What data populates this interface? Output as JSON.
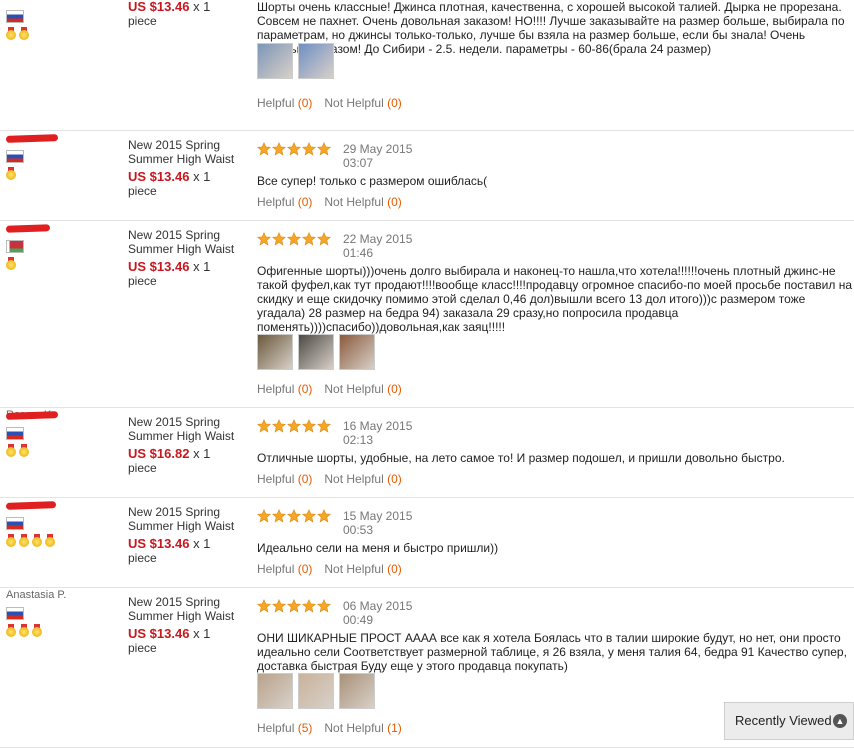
{
  "reviews": [
    {
      "user_name": "",
      "country": "ru",
      "medals": 2,
      "price": "US $13.46",
      "qty": "x 1",
      "unit": "piece",
      "product": "",
      "stars": 5,
      "date": "",
      "time": "",
      "text": "Шорты очень классные! Джинса плотная, качественна, с хорошей высокой талией. Дырка не прорезана. Совсем не пахнет. Очень довольная заказом! НО!!!! Лучше заказывайте на размер больше, выбирала по параметрам, но джинсы только-только, лучше бы взяла на размер больше, если бы знала! Очень довольна заказом! До Сибири - 2.5. недели. параметры - 60-86(брала 24 размер)",
      "photos": 2,
      "helpful": "Helpful",
      "helpful_count": "(0)",
      "not_helpful": "Not Helpful",
      "not_helpful_count": "(0)"
    },
    {
      "user_name": "",
      "country": "ru",
      "medals": 1,
      "price": "US $13.46",
      "qty": "x 1",
      "unit": "piece",
      "product": "New 2015 Spring Summer High Waist",
      "stars": 5,
      "date": "29 May 2015",
      "time": "03:07",
      "text": "Все супер! только с размером ошиблась(",
      "photos": 0,
      "helpful": "Helpful",
      "helpful_count": "(0)",
      "not_helpful": "Not Helpful",
      "not_helpful_count": "(0)"
    },
    {
      "user_name": "",
      "country": "by",
      "medals": 1,
      "price": "US $13.46",
      "qty": "x 1",
      "unit": "piece",
      "product": "New 2015 Spring Summer High Waist",
      "stars": 5,
      "date": "22 May 2015",
      "time": "01:46",
      "text": "Офигенные шорты)))очень долго выбирала и наконец-то нашла,что хотела!!!!!!очень плотный джинс-не такой фуфел,как тут продают!!!!вообще класс!!!!продавцу огромное спасибо-по моей просьбе поставил на скидку и еще скидочку помимо этой сделал 0,46 дол)вышли всего 13 дол итого)))с размером тоже угадала) 28 размер на бедра 94) заказала 29 сразу,но попросила продавца поменять))))спасибо))довольная,как заяц!!!!!",
      "photos": 3,
      "helpful": "Helpful",
      "helpful_count": "(0)",
      "not_helpful": "Not Helpful",
      "not_helpful_count": "(0)"
    },
    {
      "user_name": "Rosma K.",
      "country": "ru",
      "medals": 2,
      "price": "US $16.82",
      "qty": "x 1",
      "unit": "piece",
      "product": "New 2015 Spring Summer High Waist",
      "stars": 5,
      "date": "16 May 2015",
      "time": "02:13",
      "text": "Отличные шорты, удобные, на лето самое то! И размер подошел, и пришли довольно быстро.",
      "photos": 0,
      "helpful": "Helpful",
      "helpful_count": "(0)",
      "not_helpful": "Not Helpful",
      "not_helpful_count": "(0)"
    },
    {
      "user_name": "",
      "country": "ru",
      "medals": 4,
      "price": "US $13.46",
      "qty": "x 1",
      "unit": "piece",
      "product": "New 2015 Spring Summer High Waist",
      "stars": 5,
      "date": "15 May 2015",
      "time": "00:53",
      "text": "Идеально сели на меня и быстро пришли))",
      "photos": 0,
      "helpful": "Helpful",
      "helpful_count": "(0)",
      "not_helpful": "Not Helpful",
      "not_helpful_count": "(0)"
    },
    {
      "user_name": "Anastasia P.",
      "country": "ru",
      "medals": 3,
      "price": "US $13.46",
      "qty": "x 1",
      "unit": "piece",
      "product": "New 2015 Spring Summer High Waist",
      "stars": 5,
      "date": "06 May 2015",
      "time": "00:49",
      "text": "ОНИ ШИКАРНЫЕ ПРОСТ АААА все как я хотела Боялась что в талии широкие будут, но нет, они просто идеально сели Соответствует размерной таблице, я 26 взяла, у меня талия 64, бедра 91 Качество супер, доставка быстрая Буду еще у этого продавца покупать)",
      "photos": 3,
      "helpful": "Helpful",
      "helpful_count": "(5)",
      "not_helpful": "Not Helpful",
      "not_helpful_count": "(1)"
    }
  ],
  "recently_viewed": {
    "label": "Recently Viewed"
  },
  "colors": {
    "price": "#c8171e",
    "count": "#e65b00",
    "star": "#f5a623"
  }
}
